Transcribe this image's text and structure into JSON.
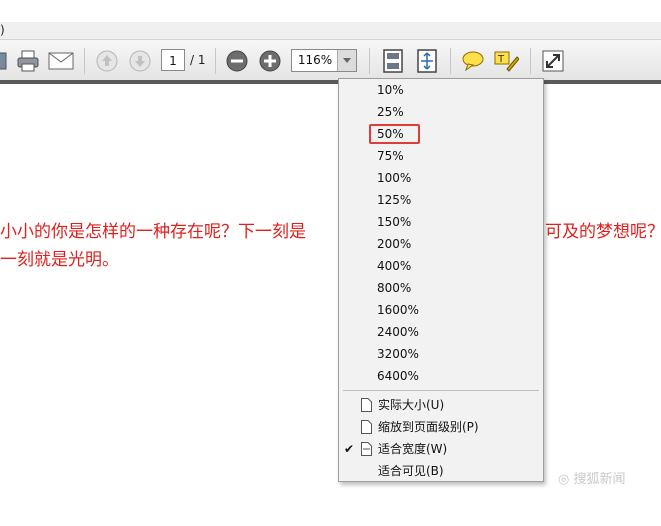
{
  "menubar": {
    "fragment": ")"
  },
  "toolbar": {
    "page_current": "1",
    "page_total": "/ 1",
    "zoom_value": "116%"
  },
  "document": {
    "line1_left": "小小的你是怎样的一种存在呢？下一刻是",
    "line1_right": "可及的梦想呢？",
    "line2": "一刻就是光明。"
  },
  "zoom_menu": {
    "levels": [
      "10%",
      "25%",
      "50%",
      "75%",
      "100%",
      "125%",
      "150%",
      "200%",
      "400%",
      "800%",
      "1600%",
      "2400%",
      "3200%",
      "6400%"
    ],
    "highlighted": "50%",
    "commands": [
      {
        "label": "实际大小(U)",
        "checked": false
      },
      {
        "label": "缩放到页面级别(P)",
        "checked": false
      },
      {
        "label": "适合宽度(W)",
        "checked": true
      },
      {
        "label": "适合可见(B)",
        "checked": false
      }
    ],
    "highlight_color": "#e23b3b"
  },
  "watermark": "◎ 搜狐新闻",
  "icons": [
    "save-icon",
    "print-icon",
    "email-icon",
    "arrow-up-icon",
    "arrow-down-icon",
    "zoom-out-icon",
    "zoom-in-icon",
    "zoom-dropdown-icon",
    "single-page-icon",
    "fit-page-icon",
    "comment-icon",
    "highlight-note-icon",
    "fullscreen-icon",
    "page-icon",
    "checkmark-icon"
  ]
}
